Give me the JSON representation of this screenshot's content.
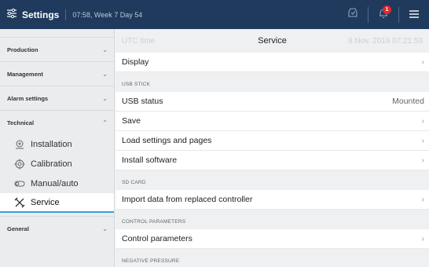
{
  "header": {
    "title": "Settings",
    "time": "07:58, Week 7 Day 54",
    "badge_count": "1",
    "colors": {
      "bar": "#1f3a5c",
      "badge": "#e3262e",
      "accent": "#3aa0d8"
    }
  },
  "sidebar": {
    "groups": {
      "production": "Production",
      "management": "Management",
      "alarm": "Alarm settings",
      "technical": "Technical",
      "general": "General"
    },
    "items": {
      "installation": "Installation",
      "calibration": "Calibration",
      "manual_auto": "Manual/auto",
      "service": "Service"
    }
  },
  "main": {
    "title": "Service",
    "ghost_left": "UTC time",
    "ghost_right": "8 Nov. 2019 07:21:53",
    "rows": {
      "display": "Display",
      "usb_status": "USB status",
      "usb_status_value": "Mounted",
      "save": "Save",
      "load_settings": "Load settings and pages",
      "install_software": "Install software",
      "import_data": "Import data from replaced controller",
      "control_parameters": "Control parameters"
    },
    "sections": {
      "usb_stick": "USB STICK",
      "sd_card": "SD CARD",
      "control_parameters": "CONTROL PARAMETERS",
      "negative_pressure": "NEGATIVE PRESSURE"
    }
  }
}
